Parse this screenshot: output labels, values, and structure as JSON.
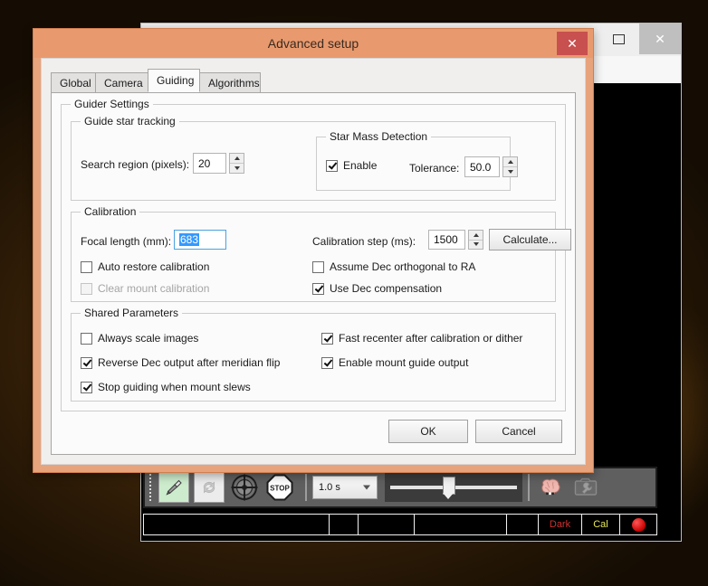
{
  "desktop": {
    "wallpaper_tone": "#3a2409"
  },
  "background_window": {
    "name": "phd2-main-window",
    "titlebar": {
      "minimize_glyph": "minimize-icon",
      "maximize_glyph": "maximize-icon",
      "close_label": "✕"
    },
    "controlbar": {
      "buttons": [
        {
          "name": "connect-equipment-button",
          "icon": "usb-plug-icon",
          "state": "enabled"
        },
        {
          "name": "loop-exposures-button",
          "icon": "loop-refresh-icon",
          "state": "disabled"
        },
        {
          "name": "guide-button",
          "icon": "crosshair-target-icon",
          "state": "enabled"
        },
        {
          "name": "stop-button",
          "icon": "stop-octagon-icon",
          "state": "enabled"
        }
      ],
      "exposure": {
        "value": "1.0 s",
        "caret": "chevron-down-icon"
      },
      "gain_slider": {
        "name": "gain-slider",
        "position_pct": 42
      },
      "right_buttons": [
        {
          "name": "advanced-brain-button",
          "icon": "brain-icon",
          "state": "enabled"
        },
        {
          "name": "camera-settings-button",
          "icon": "camera-wrench-icon",
          "state": "disabled"
        }
      ]
    },
    "statusbar": {
      "cells": [
        {
          "name": "status-cell-main",
          "text": "",
          "color": "#ffffff"
        },
        {
          "name": "status-cell-2",
          "text": "",
          "color": "#ffffff"
        },
        {
          "name": "status-cell-3",
          "text": "",
          "color": "#ffffff"
        },
        {
          "name": "status-cell-4",
          "text": "",
          "color": "#ffffff"
        },
        {
          "name": "status-cell-5",
          "text": "",
          "color": "#ffffff"
        },
        {
          "name": "status-cell-dark",
          "text": "Dark",
          "color": "#d03030"
        },
        {
          "name": "status-cell-cal",
          "text": "Cal",
          "color": "#e8e85a"
        },
        {
          "name": "status-cell-indicator",
          "text": "",
          "color": "#e01010"
        }
      ]
    }
  },
  "dialog": {
    "title": "Advanced setup",
    "close_label": "✕",
    "accent": "#e89a6e",
    "close_button_color": "#c8504f",
    "tabs": [
      {
        "label": "Global",
        "active": false
      },
      {
        "label": "Camera",
        "active": false
      },
      {
        "label": "Guiding",
        "active": true
      },
      {
        "label": "Algorithms",
        "active": false
      }
    ],
    "guider_settings": {
      "legend": "Guider Settings",
      "guide_star_tracking": {
        "legend": "Guide star tracking",
        "search_region_label": "Search region (pixels):",
        "search_region_value": "20",
        "star_mass_detection": {
          "legend": "Star Mass Detection",
          "enable_label": "Enable",
          "enable_checked": true,
          "tolerance_label": "Tolerance:",
          "tolerance_value": "50.0"
        }
      },
      "calibration": {
        "legend": "Calibration",
        "focal_length_label": "Focal length (mm):",
        "focal_length_value": "683",
        "focal_length_selected": true,
        "calibration_step_label": "Calibration step (ms):",
        "calibration_step_value": "1500",
        "calculate_label": "Calculate...",
        "checkboxes": [
          {
            "label": "Auto restore calibration",
            "checked": false,
            "disabled": false
          },
          {
            "label": "Clear mount calibration",
            "checked": false,
            "disabled": true
          },
          {
            "label": "Assume Dec orthogonal to RA",
            "checked": false,
            "disabled": false
          },
          {
            "label": "Use Dec compensation",
            "checked": true,
            "disabled": false
          }
        ]
      },
      "shared_parameters": {
        "legend": "Shared Parameters",
        "checkboxes": [
          {
            "label": "Always scale images",
            "checked": false
          },
          {
            "label": "Reverse Dec output after meridian flip",
            "checked": true
          },
          {
            "label": "Stop guiding when mount slews",
            "checked": true
          },
          {
            "label": "Fast recenter after calibration or dither",
            "checked": true
          },
          {
            "label": "Enable mount guide output",
            "checked": true
          }
        ]
      }
    },
    "footer": {
      "ok_label": "OK",
      "cancel_label": "Cancel"
    }
  }
}
